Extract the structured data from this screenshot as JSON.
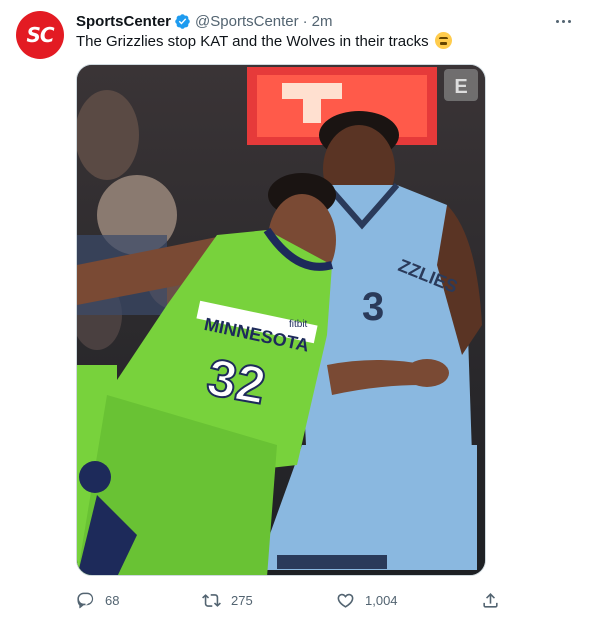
{
  "tweet": {
    "display_name": "SportsCenter",
    "handle": "@SportsCenter",
    "separator": "·",
    "time": "2m",
    "text": "The Grizzlies stop KAT and the Wolves in their tracks",
    "emoji": "face-with-steam-emoji",
    "avatar_text": "SC"
  },
  "media": {
    "jersey_left_team": "MINNESOTA",
    "jersey_left_number": "32",
    "jersey_left_sponsor": "fitbit",
    "jersey_right_team": "ZZLIES",
    "jersey_right_number": "3",
    "watermark": "E"
  },
  "actions": {
    "replies": "68",
    "retweets": "275",
    "likes": "1,004"
  },
  "colors": {
    "verified": "#1d9bf0",
    "brand_red": "#e31b23",
    "muted": "#536471"
  }
}
